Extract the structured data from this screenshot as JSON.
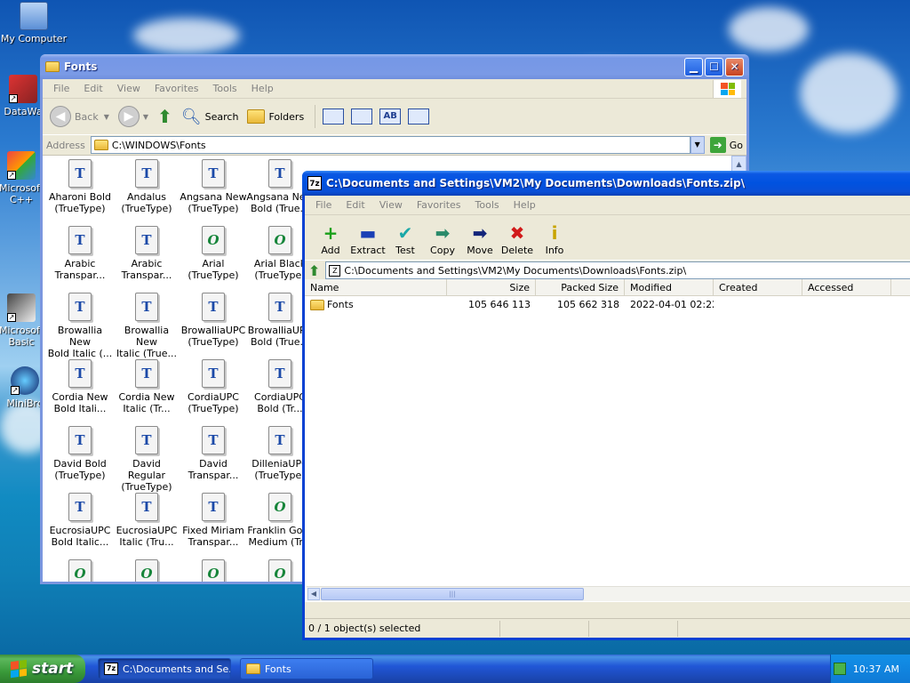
{
  "desktop": {
    "icons": [
      {
        "label": "My Computer"
      },
      {
        "label": "DataWa"
      },
      {
        "label": "Microsoft C++"
      },
      {
        "label": "Microsoft Basic"
      },
      {
        "label": "MiniBro"
      }
    ]
  },
  "fonts_window": {
    "title": "Fonts",
    "menu": [
      "File",
      "Edit",
      "View",
      "Favorites",
      "Tools",
      "Help"
    ],
    "toolbar": {
      "back": "Back",
      "search": "Search",
      "folders": "Folders"
    },
    "address_label": "Address",
    "address_value": "C:\\WINDOWS\\Fonts",
    "go_label": "Go",
    "items": [
      {
        "line1": "Aharoni Bold",
        "line2": "(TrueType)",
        "type": "tt"
      },
      {
        "line1": "Andalus",
        "line2": "(TrueType)",
        "type": "tt"
      },
      {
        "line1": "Angsana New",
        "line2": "(TrueType)",
        "type": "tt"
      },
      {
        "line1": "Angsana New",
        "line2": "Bold (True...",
        "type": "tt"
      },
      {
        "line1": "Arabic",
        "line2": "Transpar...",
        "type": "tt"
      },
      {
        "line1": "Arabic",
        "line2": "Transpar...",
        "type": "tt"
      },
      {
        "line1": "Arial",
        "line2": "(TrueType)",
        "type": "ot"
      },
      {
        "line1": "Arial Black",
        "line2": "(TrueType)",
        "type": "ot"
      },
      {
        "line1": "Browallia New",
        "line2": "Bold Italic (...",
        "type": "tt"
      },
      {
        "line1": "Browallia New",
        "line2": "Italic (True...",
        "type": "tt"
      },
      {
        "line1": "BrowalliaUPC",
        "line2": "(TrueType)",
        "type": "tt"
      },
      {
        "line1": "BrowalliaUPC",
        "line2": "Bold (True...",
        "type": "tt"
      },
      {
        "line1": "Cordia New",
        "line2": "Bold Itali...",
        "type": "tt"
      },
      {
        "line1": "Cordia New",
        "line2": "Italic (Tr...",
        "type": "tt"
      },
      {
        "line1": "CordiaUPC",
        "line2": "(TrueType)",
        "type": "tt"
      },
      {
        "line1": "CordiaUPC",
        "line2": "Bold (Tr...",
        "type": "tt"
      },
      {
        "line1": "David Bold",
        "line2": "(TrueType)",
        "type": "tt"
      },
      {
        "line1": "David Regular",
        "line2": "(TrueType)",
        "type": "tt"
      },
      {
        "line1": "David",
        "line2": "Transpar...",
        "type": "tt"
      },
      {
        "line1": "DilleniaUPC",
        "line2": "(TrueType)",
        "type": "tt"
      },
      {
        "line1": "EucrosiaUPC",
        "line2": "Bold Italic...",
        "type": "tt"
      },
      {
        "line1": "EucrosiaUPC",
        "line2": "Italic (Tru...",
        "type": "tt"
      },
      {
        "line1": "Fixed Miriam",
        "line2": "Transpar...",
        "type": "tt"
      },
      {
        "line1": "Franklin Goth",
        "line2": "Medium (Tr...",
        "type": "ot"
      },
      {
        "line1": "",
        "line2": "",
        "type": "ot"
      },
      {
        "line1": "",
        "line2": "",
        "type": "ot"
      },
      {
        "line1": "",
        "line2": "",
        "type": "ot"
      },
      {
        "line1": "",
        "line2": "",
        "type": "ot"
      }
    ]
  },
  "zip_window": {
    "title": "C:\\Documents and Settings\\VM2\\My Documents\\Downloads\\Fonts.zip\\",
    "menu": [
      "File",
      "Edit",
      "View",
      "Favorites",
      "Tools",
      "Help"
    ],
    "toolbar": [
      {
        "label": "Add",
        "icon": "add-icon",
        "glyph": "+",
        "color": "#1aa01a"
      },
      {
        "label": "Extract",
        "icon": "extract-icon",
        "glyph": "▬",
        "color": "#1a3fb5"
      },
      {
        "label": "Test",
        "icon": "test-icon",
        "glyph": "✔",
        "color": "#1aa8a8"
      },
      {
        "label": "Copy",
        "icon": "copy-icon",
        "glyph": "➡",
        "color": "#2a8a6a"
      },
      {
        "label": "Move",
        "icon": "move-icon",
        "glyph": "➡",
        "color": "#13257a"
      },
      {
        "label": "Delete",
        "icon": "delete-icon",
        "glyph": "✖",
        "color": "#d11a1a"
      },
      {
        "label": "Info",
        "icon": "info-icon",
        "glyph": "i",
        "color": "#c8a400"
      }
    ],
    "path": "C:\\Documents and Settings\\VM2\\My Documents\\Downloads\\Fonts.zip\\",
    "columns": [
      "Name",
      "Size",
      "Packed Size",
      "Modified",
      "Created",
      "Accessed"
    ],
    "rows": [
      {
        "name": "Fonts",
        "size": "105 646 113",
        "packed": "105 662 318",
        "modified": "2022-04-01 02:22",
        "created": "",
        "accessed": ""
      }
    ],
    "status": "0 / 1 object(s) selected"
  },
  "taskbar": {
    "start_label": "start",
    "tasks": [
      {
        "label": "C:\\Documents and Se...",
        "icon": "7zip-icon"
      },
      {
        "label": "Fonts",
        "icon": "folder-icon"
      }
    ],
    "clock": "10:37 AM"
  }
}
